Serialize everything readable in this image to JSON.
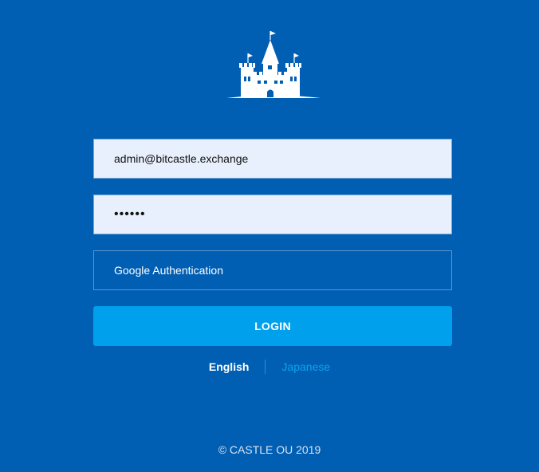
{
  "login_form": {
    "email_value": "admin@bitcastle.exchange",
    "password_value": "••••••",
    "otp_placeholder": "Google Authentication",
    "login_label": "LOGIN"
  },
  "language": {
    "options": [
      "English",
      "Japanese"
    ],
    "selected": "English"
  },
  "footer": {
    "copyright": "© CASTLE OU 2019"
  },
  "colors": {
    "background": "#005eb3",
    "button": "#00a0ec",
    "input_fill": "#e8f0fe"
  },
  "icons": {
    "logo": "castle-icon"
  }
}
